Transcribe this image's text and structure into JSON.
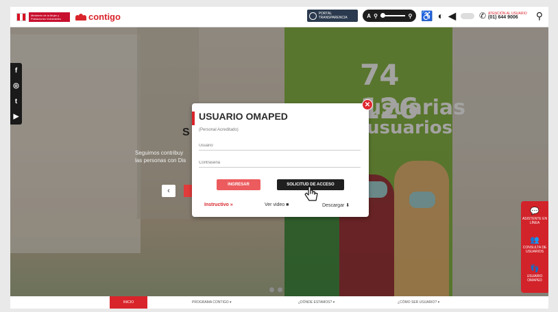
{
  "header": {
    "gov_logo_text": "Ministerio de la Mujer y Poblaciones Vulnerables",
    "brand": "contigo",
    "portal_label": "PORTAL TRANSPARENCIA",
    "zoom_label": "A",
    "attention_label": "ATENCIÓN AL USUARIO",
    "attention_phone": "(01) 644 9006"
  },
  "hero": {
    "counter": "74 126",
    "word1": "usuarias",
    "word2": "usuarios",
    "title_peek": "S",
    "text_line1": "Seguimos contribuy",
    "text_line2": "las personas con Dis",
    "arrow": "‹"
  },
  "social": [
    "f",
    "◎",
    "t",
    "▶"
  ],
  "side_tools": [
    {
      "icon": "💬",
      "label": "ASISTENTE EN LÍNEA"
    },
    {
      "icon": "👥",
      "label": "CONSULTA DE USUARIOS"
    },
    {
      "icon": "👣",
      "label": "USUARIO OMAPED"
    }
  ],
  "nav": {
    "inicio": "INICIO",
    "programa": "PROGRAMA CONTIGO ▾",
    "donde": "¿DÓNDE ESTAMOS? ▾",
    "como": "¿CÓMO SER USUARIO? ▾"
  },
  "modal": {
    "title": "USUARIO OMAPED",
    "subtitle": "(Personal Acreditado)",
    "user_placeholder": "Usuario",
    "password_placeholder": "Contraseña",
    "login_button": "INGRESAR",
    "request_button": "SOLICITUD DE ACCESO",
    "instructivo": "Instructivo »",
    "video": "Ver video ■",
    "download": "Descargar ⬇",
    "close": "✕"
  },
  "colors": {
    "brand_red": "#d9242b",
    "green_panel": "#7fb33a"
  }
}
